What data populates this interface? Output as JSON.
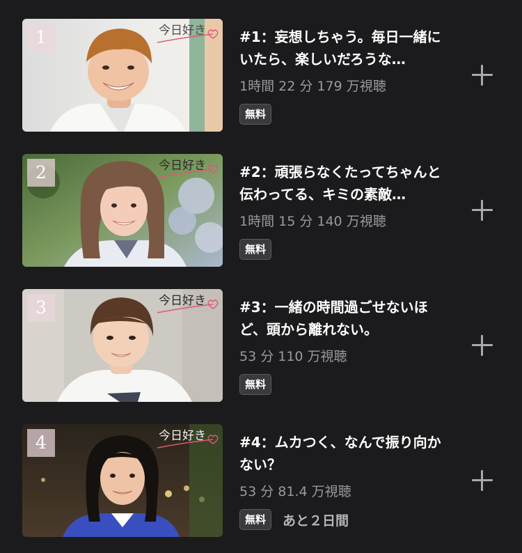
{
  "episodes": [
    {
      "thumbnail_number": "1",
      "title": "#1：妄想しちゃう。毎日一緒にいたら、楽しいだろうな…",
      "meta": "1時間 22 分 179 万視聴",
      "badge": "無料",
      "remaining": "",
      "logo_text": "今日好き"
    },
    {
      "thumbnail_number": "2",
      "title": "#2：頑張らなくたってちゃんと伝わってる、キミの素敵…",
      "meta": "1時間 15 分 140 万視聴",
      "badge": "無料",
      "remaining": "",
      "logo_text": "今日好き"
    },
    {
      "thumbnail_number": "3",
      "title": "#3：一緒の時間過ごせないほど、頭から離れない。",
      "meta": "53 分 110 万視聴",
      "badge": "無料",
      "remaining": "",
      "logo_text": "今日好き"
    },
    {
      "thumbnail_number": "4",
      "title": "#4：ムカつく、なんで振り向かない？",
      "meta": "53 分 81.4 万視聴",
      "badge": "無料",
      "remaining": "あと２日間",
      "logo_text": "今日好き"
    }
  ],
  "icons": {
    "add": "plus-icon"
  },
  "colors": {
    "background": "#1b1b1d",
    "title": "#ffffff",
    "meta": "#9a9a9f",
    "badge_bg": "#3a3a3e",
    "add_icon": "#a8a8ad",
    "logo_heart": "#e0567a"
  }
}
